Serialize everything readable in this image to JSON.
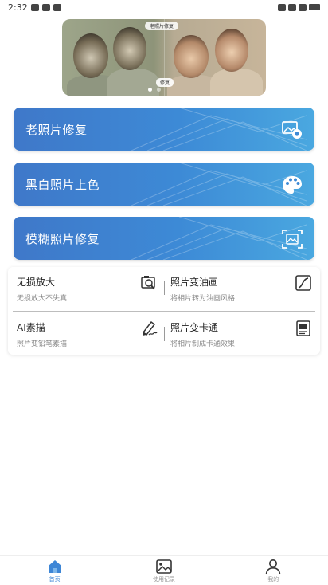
{
  "status_bar": {
    "time": "2:32"
  },
  "banner": {
    "top_label": "老照片修复",
    "after_label": "修复",
    "caption": "",
    "slides": 2,
    "active_slide": 0
  },
  "cards": [
    {
      "label": "老照片修复",
      "icon": "image-restore-icon"
    },
    {
      "label": "黑白照片上色",
      "icon": "palette-icon"
    },
    {
      "label": "模糊照片修复",
      "icon": "focus-image-icon"
    }
  ],
  "tools": [
    {
      "title": "无损放大",
      "subtitle": "无损放大不失真",
      "icon": "magnify-image-icon"
    },
    {
      "title": "照片变油画",
      "subtitle": "将相片转为油画风格",
      "icon": "oil-painting-icon"
    },
    {
      "title": "AI素描",
      "subtitle": "照片变铅笔素描",
      "icon": "pencil-sketch-icon"
    },
    {
      "title": "照片变卡通",
      "subtitle": "将相片制成卡通效果",
      "icon": "cartoon-image-icon"
    }
  ],
  "bottom_nav": [
    {
      "label": "首页",
      "icon": "home-icon",
      "active": true
    },
    {
      "label": "使用记录",
      "icon": "image-history-icon",
      "active": false
    },
    {
      "label": "我的",
      "icon": "user-icon",
      "active": false
    }
  ],
  "colors": {
    "accent": "#3d86d6",
    "card_start": "#3f78c9",
    "card_end": "#4aa8e0"
  }
}
